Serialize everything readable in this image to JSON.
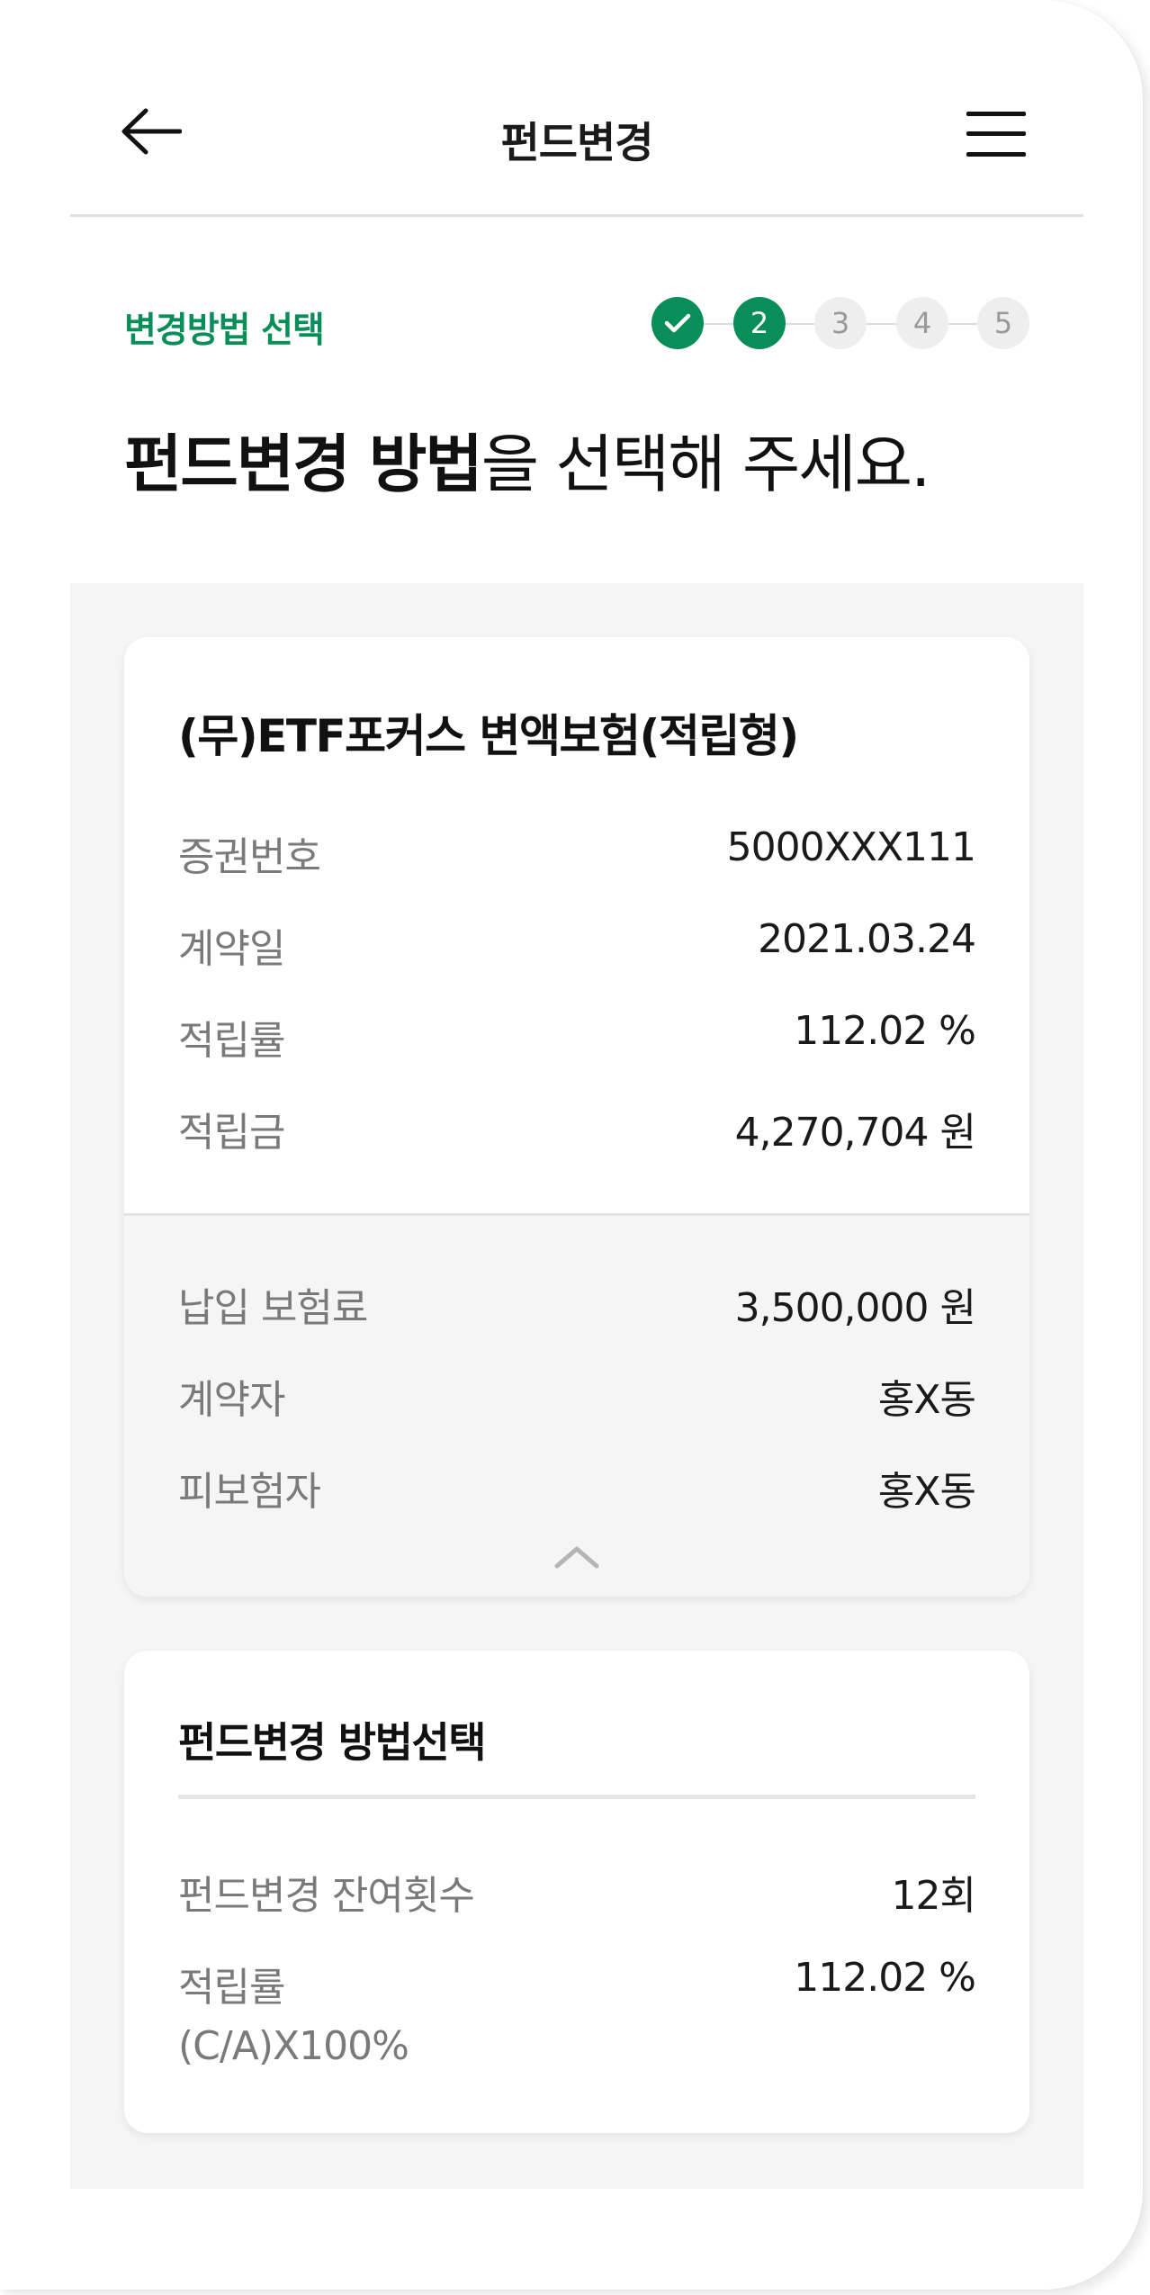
{
  "header": {
    "title": "펀드변경",
    "back_icon": "arrow-left-icon",
    "menu_icon": "hamburger-menu-icon"
  },
  "progress": {
    "label": "변경방법 선택",
    "steps": [
      "✓",
      "2",
      "3",
      "4",
      "5"
    ],
    "current_step": 2,
    "total_steps": 5
  },
  "heading": {
    "bold": "펀드변경 방법",
    "normal": "을 선택해 주세요."
  },
  "policy_card": {
    "title": "(무)ETF포커스 변액보험(적립형)",
    "details": [
      {
        "label": "증권번호",
        "value": "5000XXX111"
      },
      {
        "label": "계약일",
        "value": "2021.03.24"
      },
      {
        "label": "적립률",
        "value": "112.02 %"
      },
      {
        "label": "적립금",
        "value": "4,270,704 원"
      }
    ],
    "extra": [
      {
        "label": "납입 보험료",
        "value": "3,500,000 원"
      },
      {
        "label": "계약자",
        "value": "홍X동"
      },
      {
        "label": "피보험자",
        "value": "홍X동"
      }
    ],
    "collapse_icon": "chevron-up-icon"
  },
  "method_card": {
    "title": "펀드변경 방법선택",
    "rows": [
      {
        "label": "펀드변경 잔여횟수",
        "value": "12회"
      },
      {
        "label": "적립률",
        "value": "112.02 %"
      }
    ],
    "note": "(C/A)X100%"
  },
  "colors": {
    "accent": "#0a8e59",
    "step_inactive_bg": "#eeeeee",
    "step_inactive_text": "#999999",
    "panel_bg": "#f5f5f5",
    "label_text": "#7a7a7a"
  }
}
